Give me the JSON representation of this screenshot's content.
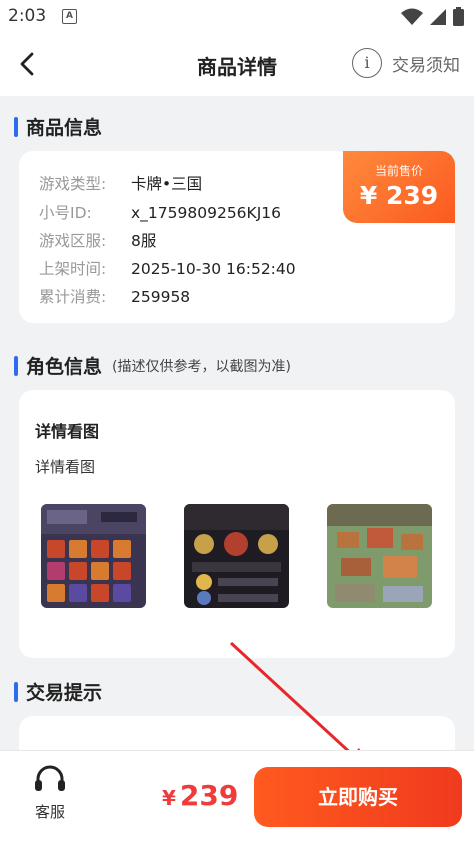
{
  "status_bar": {
    "time": "2:03",
    "notif_icon_letter": "A"
  },
  "nav": {
    "title": "商品详情",
    "notice_label": "交易须知",
    "notice_icon_text": "i"
  },
  "product_info": {
    "heading": "商品信息",
    "price_label": "当前售价",
    "price": "¥ 239",
    "rows": [
      {
        "key": "游戏类型:",
        "value": "卡牌•三国"
      },
      {
        "key": "小号ID:",
        "value": "x_1759809256KJ16"
      },
      {
        "key": "游戏区服:",
        "value": "8服"
      },
      {
        "key": "上架时间:",
        "value": "2025-10-30 16:52:40"
      },
      {
        "key": "累计消费:",
        "value": "259958"
      }
    ]
  },
  "role_info": {
    "heading": "角色信息",
    "note": "(描述仅供参考，以截图为准)",
    "detail_title": "详情看图",
    "detail_text": "详情看图",
    "thumbnails": [
      "game-screenshot-1",
      "game-screenshot-2",
      "game-screenshot-3"
    ]
  },
  "trade_tips": {
    "heading": "交易提示"
  },
  "bottom_bar": {
    "service_label": "客服",
    "currency": "¥",
    "total": "239",
    "buy_label": "立即购买"
  },
  "colors": {
    "accent_blue": "#2f6bf0",
    "price_red": "#ee3b3b",
    "buy_orange": "#ff5a1f",
    "arrow_red": "#e8272a"
  }
}
